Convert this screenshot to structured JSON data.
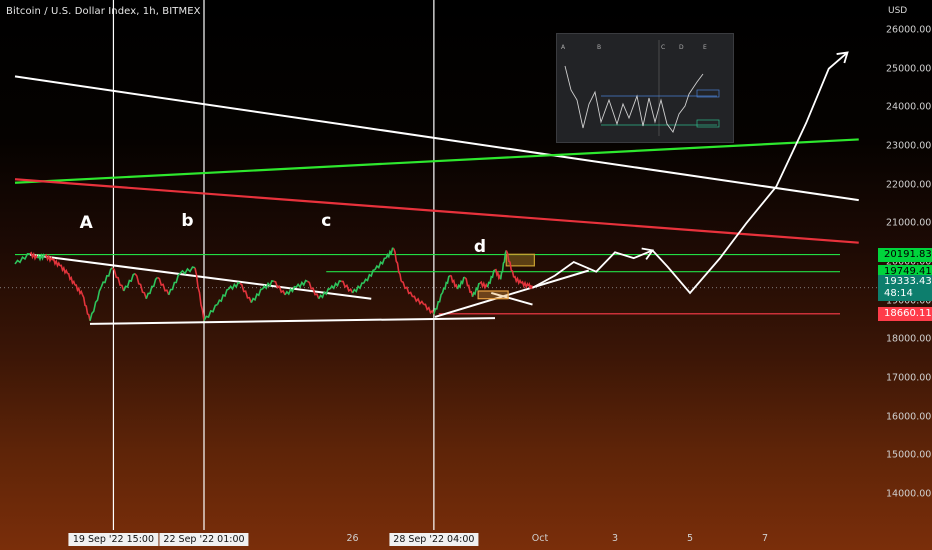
{
  "header": {
    "title": "Bitcoin / U.S. Dollar Index, 1h, BITMEX",
    "currency": "USD"
  },
  "colors": {
    "green_line": "#2ee82e",
    "red_line": "#e8323c",
    "white_line": "#ffffff",
    "support_line": "#ff3c4a",
    "level_line": "#22dd44",
    "price_up": "#2ec45c",
    "price_down": "#e2343c"
  },
  "chart_data": {
    "type": "line",
    "title": "Bitcoin / U.S. Dollar Index, 1h, BITMEX",
    "xlabel": "",
    "ylabel": "USD",
    "ylim": [
      13300,
      26600
    ],
    "y_ticks": [
      "26000.00",
      "25000.00",
      "24000.00",
      "23000.00",
      "22000.00",
      "21000.00",
      "20000.00",
      "19000.00",
      "18000.00",
      "17000.00",
      "16000.00",
      "15000.00",
      "14000.00"
    ],
    "y_tick_values": [
      26000,
      25000,
      24000,
      23000,
      22000,
      21000,
      20000,
      19000,
      18000,
      17000,
      16000,
      15000,
      14000
    ],
    "x_ticks": [
      {
        "label": "26",
        "day": 26.0
      },
      {
        "label": "Oct",
        "day": 31.0
      },
      {
        "label": "3",
        "day": 33.0
      },
      {
        "label": "5",
        "day": 35.0
      },
      {
        "label": "7",
        "day": 37.0
      }
    ],
    "x_highlight_ticks": [
      {
        "label": "19 Sep '22   15:00",
        "day": 19.625
      },
      {
        "label": "22 Sep '22   01:00",
        "day": 22.04
      },
      {
        "label": "28 Sep '22   04:00",
        "day": 28.17
      }
    ],
    "wave_labels": [
      {
        "text": "A",
        "day": 18.9,
        "price": 21000
      },
      {
        "text": "b",
        "day": 21.6,
        "price": 21050
      },
      {
        "text": "c",
        "day": 25.3,
        "price": 21050
      },
      {
        "text": "d",
        "day": 29.4,
        "price": 20400
      }
    ],
    "price_tags": [
      {
        "label": "20191.83",
        "value": 20191.83,
        "style": "green"
      },
      {
        "label": "19749.41",
        "value": 19749.41,
        "style": "green"
      },
      {
        "label": "19333.43",
        "sublabel": "48:14",
        "value": 19333.43,
        "style": "teal"
      },
      {
        "label": "18660.11",
        "value": 18660.11,
        "style": "red"
      }
    ],
    "horizontal_levels": [
      {
        "value": 20191.83,
        "day_start": 17.0,
        "day_end": 39.0
      },
      {
        "value": 19749.41,
        "day_start": 25.3,
        "day_end": 39.0
      },
      {
        "value": 18660.11,
        "day_start": 28.3,
        "day_end": 39.0
      }
    ],
    "trend_lines": [
      {
        "name": "",
        "color": "white",
        "points": [
          [
            17.0,
            24800
          ],
          [
            39.5,
            21600
          ]
        ]
      },
      {
        "name": "",
        "color": "green",
        "points": [
          [
            17.0,
            22050
          ],
          [
            39.5,
            23170
          ]
        ]
      },
      {
        "name": "",
        "color": "red",
        "points": [
          [
            17.0,
            22140
          ],
          [
            39.5,
            20500
          ]
        ]
      },
      {
        "name": "",
        "color": "white",
        "points": [
          [
            17.4,
            20190
          ],
          [
            26.5,
            19050
          ]
        ]
      },
      {
        "name": "",
        "color": "white",
        "points": [
          [
            19.0,
            18400
          ],
          [
            29.8,
            18550
          ]
        ]
      },
      {
        "name": "",
        "color": "white",
        "points": [
          [
            28.2,
            18580
          ],
          [
            32.3,
            19780
          ]
        ]
      },
      {
        "name": "",
        "color": "white",
        "points": [
          [
            29.7,
            19200
          ],
          [
            30.8,
            18900
          ]
        ]
      }
    ],
    "price_series": {
      "name": "",
      "points": [
        [
          17.0,
          19950
        ],
        [
          17.4,
          20210
        ],
        [
          17.6,
          20100
        ],
        [
          17.8,
          20150
        ],
        [
          18.0,
          20050
        ],
        [
          18.2,
          19900
        ],
        [
          18.4,
          19700
        ],
        [
          18.6,
          19400
        ],
        [
          18.8,
          19150
        ],
        [
          19.0,
          18480
        ],
        [
          19.3,
          19350
        ],
        [
          19.6,
          19850
        ],
        [
          19.9,
          19250
        ],
        [
          20.2,
          19700
        ],
        [
          20.5,
          19050
        ],
        [
          20.8,
          19600
        ],
        [
          21.1,
          19150
        ],
        [
          21.4,
          19700
        ],
        [
          21.8,
          19850
        ],
        [
          22.04,
          18480
        ],
        [
          22.4,
          18900
        ],
        [
          22.7,
          19300
        ],
        [
          23.0,
          19450
        ],
        [
          23.3,
          18950
        ],
        [
          23.6,
          19300
        ],
        [
          23.9,
          19500
        ],
        [
          24.2,
          19150
        ],
        [
          24.5,
          19350
        ],
        [
          24.8,
          19500
        ],
        [
          25.1,
          19050
        ],
        [
          25.4,
          19300
        ],
        [
          25.7,
          19500
        ],
        [
          26.0,
          19200
        ],
        [
          26.3,
          19450
        ],
        [
          26.6,
          19800
        ],
        [
          26.9,
          20100
        ],
        [
          27.1,
          20350
        ],
        [
          27.3,
          19500
        ],
        [
          27.6,
          19100
        ],
        [
          27.9,
          18900
        ],
        [
          28.17,
          18650
        ],
        [
          28.4,
          19200
        ],
        [
          28.6,
          19650
        ],
        [
          28.8,
          19300
        ],
        [
          29.0,
          19600
        ],
        [
          29.2,
          19100
        ],
        [
          29.4,
          19450
        ],
        [
          29.6,
          19350
        ],
        [
          29.8,
          19800
        ],
        [
          29.95,
          19550
        ],
        [
          30.1,
          20300
        ],
        [
          30.3,
          19600
        ],
        [
          30.5,
          19450
        ],
        [
          30.7,
          19380
        ],
        [
          30.8,
          19333
        ]
      ]
    },
    "projection": {
      "name": "",
      "points": [
        [
          30.8,
          19333
        ],
        [
          31.4,
          19650
        ],
        [
          31.9,
          20000
        ],
        [
          32.5,
          19750
        ],
        [
          33.0,
          20250
        ],
        [
          33.5,
          20100
        ],
        [
          34.0,
          20300
        ],
        [
          34.4,
          19880
        ],
        [
          35.0,
          19200
        ],
        [
          35.8,
          20100
        ],
        [
          36.5,
          21000
        ],
        [
          37.3,
          21950
        ],
        [
          38.1,
          23600
        ],
        [
          38.7,
          25000
        ],
        [
          39.2,
          25420
        ]
      ]
    },
    "highlight_boxes": [
      {
        "day_start": 29.35,
        "day_end": 30.15,
        "price_top": 19250,
        "price_bottom": 19050,
        "color": "#e8a244"
      },
      {
        "day_start": 30.1,
        "day_end": 30.85,
        "price_top": 20200,
        "price_bottom": 19900,
        "color": "#c8a030"
      }
    ]
  },
  "inset": {
    "labels": [
      "A",
      "B",
      "C",
      "D",
      "E"
    ]
  }
}
